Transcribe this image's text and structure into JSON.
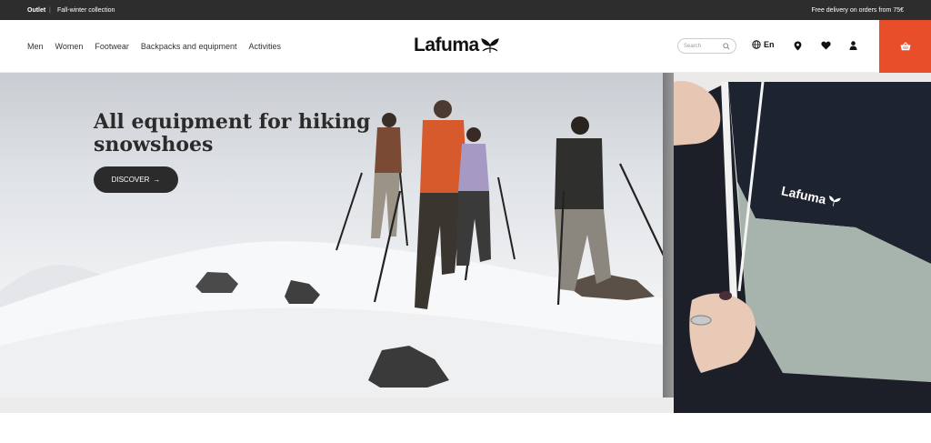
{
  "topbar": {
    "outlet": "Outlet",
    "separator": "|",
    "collection": "Fall-winter collection",
    "delivery": "Free delivery on orders from 75€"
  },
  "nav": {
    "items": [
      "Men",
      "Women",
      "Footwear",
      "Backpacks and equipment",
      "Activities"
    ]
  },
  "logo": {
    "text": "Lafuma",
    "icon": "leaf-icon"
  },
  "search": {
    "placeholder": "Search"
  },
  "lang": {
    "label": "En"
  },
  "icons": {
    "location": "location-pin-icon",
    "wishlist": "heart-icon",
    "account": "user-icon",
    "cart": "basket-icon"
  },
  "hero": {
    "title_line1": "All equipment for hiking",
    "title_line2": "snowshoes",
    "cta": "DISCOVER",
    "cta_arrow": "→"
  },
  "side": {
    "jacket_logo": "Lafuma"
  },
  "colors": {
    "accent": "#e94e2b",
    "dark": "#2d2d2d"
  }
}
